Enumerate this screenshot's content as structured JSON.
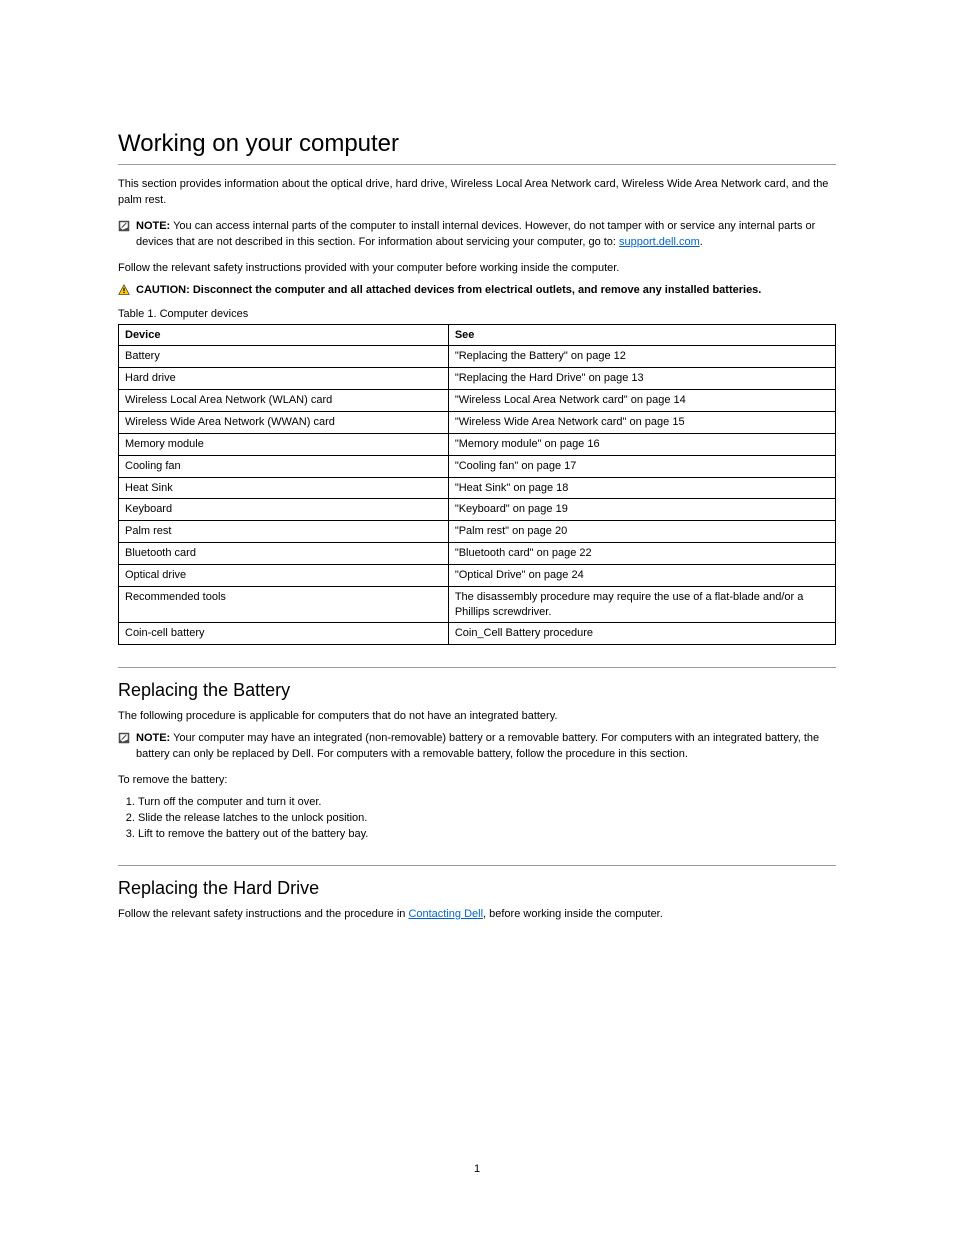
{
  "heading1": "Working on your computer",
  "intro": "This section provides information about the optical drive, hard drive, Wireless Local Area Network card, Wireless Wide Area Network card, and the palm rest.",
  "note1": {
    "label": "NOTE:",
    "body_before": "You can access internal parts of the computer to install internal devices. However, do not tamper with or service any internal parts or devices that are not described in this section. For information about servicing your computer, go to: ",
    "link_text": "support.dell.com",
    "body_after": "."
  },
  "para1": "Follow the relevant safety instructions provided with your computer before working inside the computer.",
  "caution1_label": "CAUTION:",
  "caution1_body": "Disconnect the computer and all attached devices from electrical outlets, and remove any installed batteries.",
  "table_caption": "Table 1. Computer devices",
  "table_header": {
    "col1": "Device",
    "col2": "See"
  },
  "rows": [
    {
      "c1": "Battery",
      "c2": "\"Replacing the Battery\" on page 12"
    },
    {
      "c1": "Hard drive",
      "c2": "\"Replacing the Hard Drive\" on page 13"
    },
    {
      "c1": "Wireless Local Area Network (WLAN) card",
      "c2": "\"Wireless Local Area Network card\" on page 14"
    },
    {
      "c1": "Wireless Wide Area Network (WWAN) card",
      "c2": "\"Wireless Wide Area Network card\" on page 15"
    },
    {
      "c1": "Memory module",
      "c2": "\"Memory module\" on page 16"
    },
    {
      "c1": "Cooling fan",
      "c2": "\"Cooling fan\" on page 17"
    },
    {
      "c1": "Heat Sink",
      "c2": "\"Heat Sink\" on page 18"
    },
    {
      "c1": "Keyboard",
      "c2": "\"Keyboard\" on page 19"
    },
    {
      "c1": "Palm rest",
      "c2": "\"Palm rest\" on page 20"
    },
    {
      "c1": "Bluetooth card",
      "c2": "\"Bluetooth card\" on page 22"
    },
    {
      "c1": "Optical drive",
      "c2": "\"Optical Drive\" on page 24"
    },
    {
      "c1": "Recommended tools",
      "c2": "The disassembly procedure may require the use of a flat-blade and/or a Phillips screwdriver."
    },
    {
      "c1": "Coin-cell battery",
      "c2": "Coin_Cell Battery procedure"
    }
  ],
  "heading2": "Replacing the Battery",
  "para2": "The following procedure is applicable for computers that do not have an integrated battery.",
  "note2": {
    "label": "NOTE:",
    "body": "Your computer may have an integrated (non-removable) battery or a removable battery. For computers with an integrated battery, the battery can only be replaced by Dell. For computers with a removable battery, follow the procedure in this section."
  },
  "para3": "To remove the battery:",
  "ol": [
    "Turn off the computer and turn it over.",
    "Slide the release latches to the unlock position.",
    "Lift to remove the battery out of the battery bay."
  ],
  "heading3": "Replacing the Hard Drive",
  "para4_before": "Follow the relevant safety instructions and the procedure in ",
  "para4_link": "Contacting Dell",
  "para4_after": ", before working inside the computer.",
  "footer_page": "1"
}
